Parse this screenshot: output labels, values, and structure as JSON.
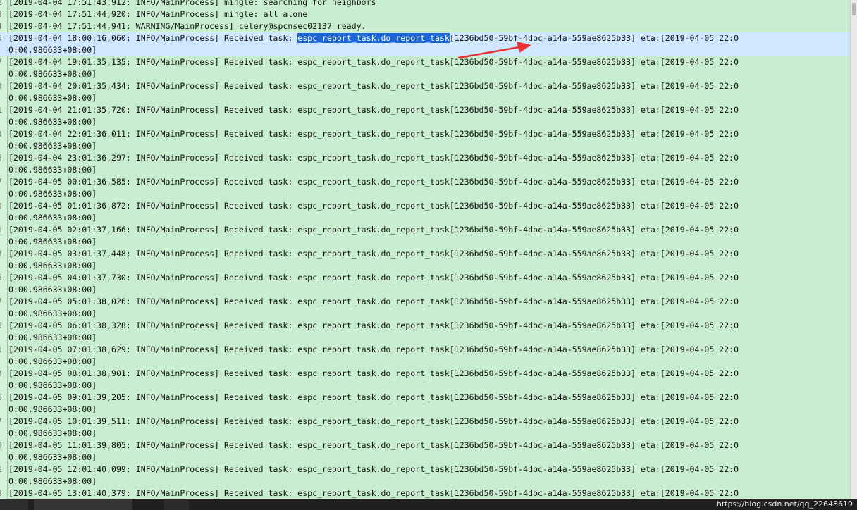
{
  "log": {
    "lines": [
      {
        "num": "2",
        "text": "[2019-04-04 17:51:43,912: INFO/MainProcess] mingle: searching for neighbors"
      },
      {
        "num": "3",
        "text": "[2019-04-04 17:51:44,920: INFO/MainProcess] mingle: all alone"
      },
      {
        "num": "4",
        "text": "[2019-04-04 17:51:44,941: WARNING/MainProcess] celery@spcnsec02137 ready."
      },
      {
        "num": "5",
        "highlight": true,
        "pre": "[2019-04-04 18:00:16,060: INFO/MainProcess] Received task: ",
        "sel": "espc_report_task.do_report_task",
        "post": "[1236bd50-59bf-4dbc-a14a-559ae8625b33] eta:[2019-04-05 22:0"
      },
      {
        "num": "",
        "highlight": true,
        "text": "0:00.986633+08:00]"
      },
      {
        "num": "7",
        "text": "[2019-04-04 19:01:35,135: INFO/MainProcess] Received task: espc_report_task.do_report_task[1236bd50-59bf-4dbc-a14a-559ae8625b33] eta:[2019-04-05 22:0"
      },
      {
        "num": "",
        "text": "0:00.986633+08:00]"
      },
      {
        "num": "9",
        "text": "[2019-04-04 20:01:35,434: INFO/MainProcess] Received task: espc_report_task.do_report_task[1236bd50-59bf-4dbc-a14a-559ae8625b33] eta:[2019-04-05 22:0"
      },
      {
        "num": "",
        "text": "0:00.986633+08:00]"
      },
      {
        "num": "1",
        "text": "[2019-04-04 21:01:35,720: INFO/MainProcess] Received task: espc_report_task.do_report_task[1236bd50-59bf-4dbc-a14a-559ae8625b33] eta:[2019-04-05 22:0"
      },
      {
        "num": "",
        "text": "0:00.986633+08:00]"
      },
      {
        "num": "3",
        "text": "[2019-04-04 22:01:36,011: INFO/MainProcess] Received task: espc_report_task.do_report_task[1236bd50-59bf-4dbc-a14a-559ae8625b33] eta:[2019-04-05 22:0"
      },
      {
        "num": "",
        "text": "0:00.986633+08:00]"
      },
      {
        "num": "5",
        "text": "[2019-04-04 23:01:36,297: INFO/MainProcess] Received task: espc_report_task.do_report_task[1236bd50-59bf-4dbc-a14a-559ae8625b33] eta:[2019-04-05 22:0"
      },
      {
        "num": "",
        "text": "0:00.986633+08:00]"
      },
      {
        "num": "7",
        "text": "[2019-04-05 00:01:36,585: INFO/MainProcess] Received task: espc_report_task.do_report_task[1236bd50-59bf-4dbc-a14a-559ae8625b33] eta:[2019-04-05 22:0"
      },
      {
        "num": "",
        "text": "0:00.986633+08:00]"
      },
      {
        "num": "9",
        "text": "[2019-04-05 01:01:36,872: INFO/MainProcess] Received task: espc_report_task.do_report_task[1236bd50-59bf-4dbc-a14a-559ae8625b33] eta:[2019-04-05 22:0"
      },
      {
        "num": "",
        "text": "0:00.986633+08:00]"
      },
      {
        "num": "1",
        "text": "[2019-04-05 02:01:37,166: INFO/MainProcess] Received task: espc_report_task.do_report_task[1236bd50-59bf-4dbc-a14a-559ae8625b33] eta:[2019-04-05 22:0"
      },
      {
        "num": "",
        "text": "0:00.986633+08:00]"
      },
      {
        "num": "3",
        "text": "[2019-04-05 03:01:37,448: INFO/MainProcess] Received task: espc_report_task.do_report_task[1236bd50-59bf-4dbc-a14a-559ae8625b33] eta:[2019-04-05 22:0"
      },
      {
        "num": "",
        "text": "0:00.986633+08:00]"
      },
      {
        "num": "5",
        "text": "[2019-04-05 04:01:37,730: INFO/MainProcess] Received task: espc_report_task.do_report_task[1236bd50-59bf-4dbc-a14a-559ae8625b33] eta:[2019-04-05 22:0"
      },
      {
        "num": "",
        "text": "0:00.986633+08:00]"
      },
      {
        "num": "7",
        "text": "[2019-04-05 05:01:38,026: INFO/MainProcess] Received task: espc_report_task.do_report_task[1236bd50-59bf-4dbc-a14a-559ae8625b33] eta:[2019-04-05 22:0"
      },
      {
        "num": "",
        "text": "0:00.986633+08:00]"
      },
      {
        "num": "9",
        "text": "[2019-04-05 06:01:38,328: INFO/MainProcess] Received task: espc_report_task.do_report_task[1236bd50-59bf-4dbc-a14a-559ae8625b33] eta:[2019-04-05 22:0"
      },
      {
        "num": "",
        "text": "0:00.986633+08:00]"
      },
      {
        "num": "1",
        "text": "[2019-04-05 07:01:38,629: INFO/MainProcess] Received task: espc_report_task.do_report_task[1236bd50-59bf-4dbc-a14a-559ae8625b33] eta:[2019-04-05 22:0"
      },
      {
        "num": "",
        "text": "0:00.986633+08:00]"
      },
      {
        "num": "3",
        "text": "[2019-04-05 08:01:38,901: INFO/MainProcess] Received task: espc_report_task.do_report_task[1236bd50-59bf-4dbc-a14a-559ae8625b33] eta:[2019-04-05 22:0"
      },
      {
        "num": "",
        "text": "0:00.986633+08:00]"
      },
      {
        "num": "5",
        "text": "[2019-04-05 09:01:39,205: INFO/MainProcess] Received task: espc_report_task.do_report_task[1236bd50-59bf-4dbc-a14a-559ae8625b33] eta:[2019-04-05 22:0"
      },
      {
        "num": "",
        "text": "0:00.986633+08:00]"
      },
      {
        "num": "7",
        "text": "[2019-04-05 10:01:39,511: INFO/MainProcess] Received task: espc_report_task.do_report_task[1236bd50-59bf-4dbc-a14a-559ae8625b33] eta:[2019-04-05 22:0"
      },
      {
        "num": "",
        "text": "0:00.986633+08:00]"
      },
      {
        "num": "9",
        "text": "[2019-04-05 11:01:39,805: INFO/MainProcess] Received task: espc_report_task.do_report_task[1236bd50-59bf-4dbc-a14a-559ae8625b33] eta:[2019-04-05 22:0"
      },
      {
        "num": "",
        "text": "0:00.986633+08:00]"
      },
      {
        "num": "1",
        "text": "[2019-04-05 12:01:40,099: INFO/MainProcess] Received task: espc_report_task.do_report_task[1236bd50-59bf-4dbc-a14a-559ae8625b33] eta:[2019-04-05 22:0"
      },
      {
        "num": "",
        "text": "0:00.986633+08:00]"
      },
      {
        "num": "3",
        "text": "[2019-04-05 13:01:40,379: INFO/MainProcess] Received task: espc_report_task.do_report_task[1236bd50-59bf-4dbc-a14a-559ae8625b33] eta:[2019-04-05 22:0"
      }
    ]
  },
  "annotation": {
    "color": "#e8312f",
    "icon": "red-arrow"
  },
  "colors": {
    "background": "#c8eecf",
    "highlight_line": "#cfe8ff",
    "selection": "#1d66d8"
  },
  "watermark": {
    "text": "https://blog.csdn.net/qq_22648619"
  }
}
